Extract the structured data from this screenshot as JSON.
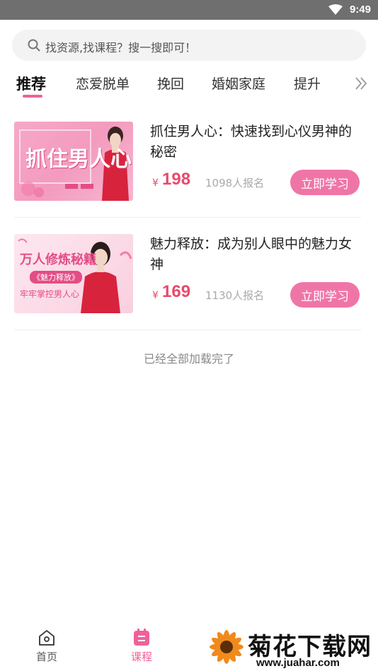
{
  "status_bar": {
    "time": "9:49"
  },
  "search": {
    "placeholder": "找资源,找课程？搜一搜即可！"
  },
  "tabs": [
    {
      "label": "推荐",
      "active": true
    },
    {
      "label": "恋爱脱单"
    },
    {
      "label": "挽回"
    },
    {
      "label": "婚姻家庭"
    },
    {
      "label": "提升"
    }
  ],
  "courses": [
    {
      "title": "抓住男人心：快速找到心仪男神的秘密",
      "currency": "¥",
      "price": "198",
      "enrolled": "1098人报名",
      "button": "立即学习",
      "thumb_text": "抓住男人心"
    },
    {
      "title": "魅力释放：成为别人眼中的魅力女神",
      "currency": "¥",
      "price": "169",
      "enrolled": "1130人报名",
      "button": "立即学习",
      "thumb_text_1": "万人修炼秘籍",
      "thumb_text_2": "《魅力释放》",
      "thumb_text_3": "牢牢掌控男人心"
    }
  ],
  "load_status": "已经全部加载完了",
  "bottom_nav": [
    {
      "label": "首页",
      "icon": "home-icon"
    },
    {
      "label": "课程",
      "icon": "course-icon",
      "active": true
    }
  ],
  "watermark": {
    "title": "菊花下载网",
    "url": "www.juahar.com"
  },
  "colors": {
    "accent": "#f0609a",
    "price": "#e84a6a",
    "button": "#f075a7"
  }
}
